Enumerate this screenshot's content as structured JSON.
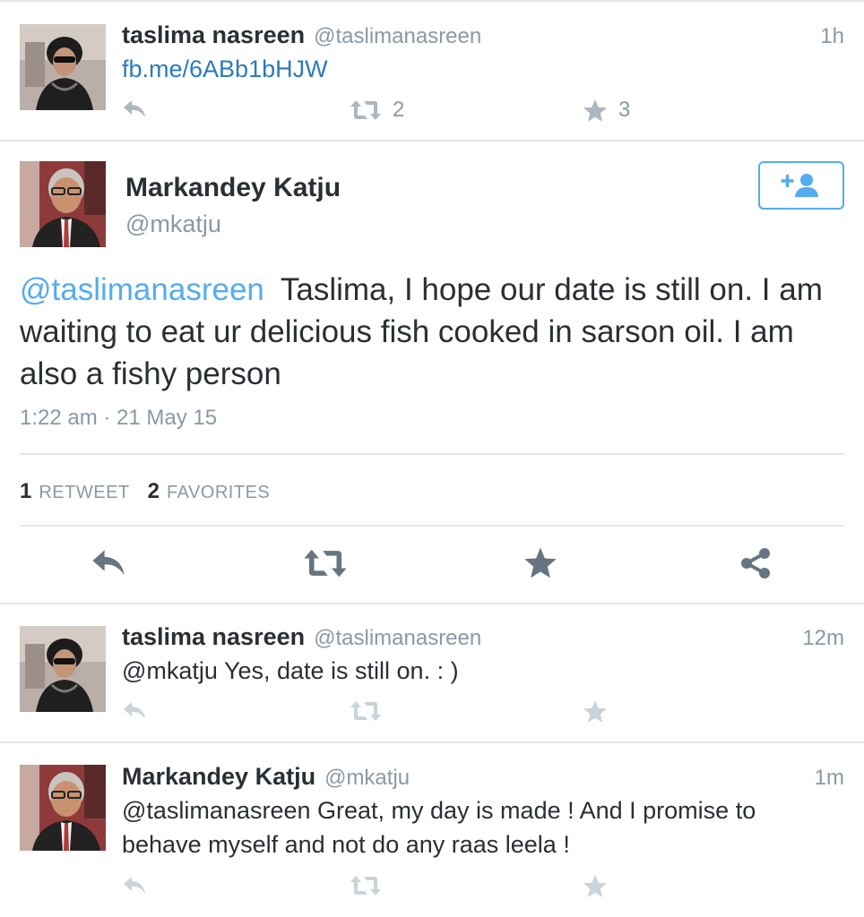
{
  "tweets": [
    {
      "name": "taslima nasreen",
      "handle": "@taslimanasreen",
      "time": "1h",
      "link": "fb.me/6ABb1bHJW",
      "retweets": "2",
      "favorites": "3",
      "avatar": "woman-with-sunglasses"
    },
    {
      "name": "taslima nasreen",
      "handle": "@taslimanasreen",
      "time": "12m",
      "text": "@mkatju Yes, date is still on. : )",
      "avatar": "woman-with-sunglasses"
    },
    {
      "name": "Markandey Katju",
      "handle": "@mkatju",
      "time": "1m",
      "text": "@taslimanasreen Great, my day is made ! And I promise to behave myself and not do any raas leela !",
      "avatar": "man-with-glasses"
    }
  ],
  "focused": {
    "name": "Markandey Katju",
    "handle": "@mkatju",
    "mention": "@taslimanasreen",
    "text": "Taslima, I hope our date is still on. I am waiting to eat ur delicious fish cooked in sarson oil. I am also a fishy person",
    "date": "1:22 am · 21 May 15",
    "retweet_count": "1",
    "retweet_label": "RETWEET",
    "favorite_count": "2",
    "favorite_label": "FAVORITES",
    "avatar": "man-with-glasses"
  },
  "icons": {
    "reply": "reply-icon",
    "retweet": "retweet-icon",
    "favorite": "star-icon",
    "share": "share-icon",
    "follow": "add-user-icon"
  },
  "colors": {
    "link": "#2b7bb9",
    "mention": "#55acee",
    "muted": "#8899a6",
    "action_icon": "#aab8c2",
    "focused_action_icon": "#66757f",
    "divider": "#e1e8ed"
  }
}
